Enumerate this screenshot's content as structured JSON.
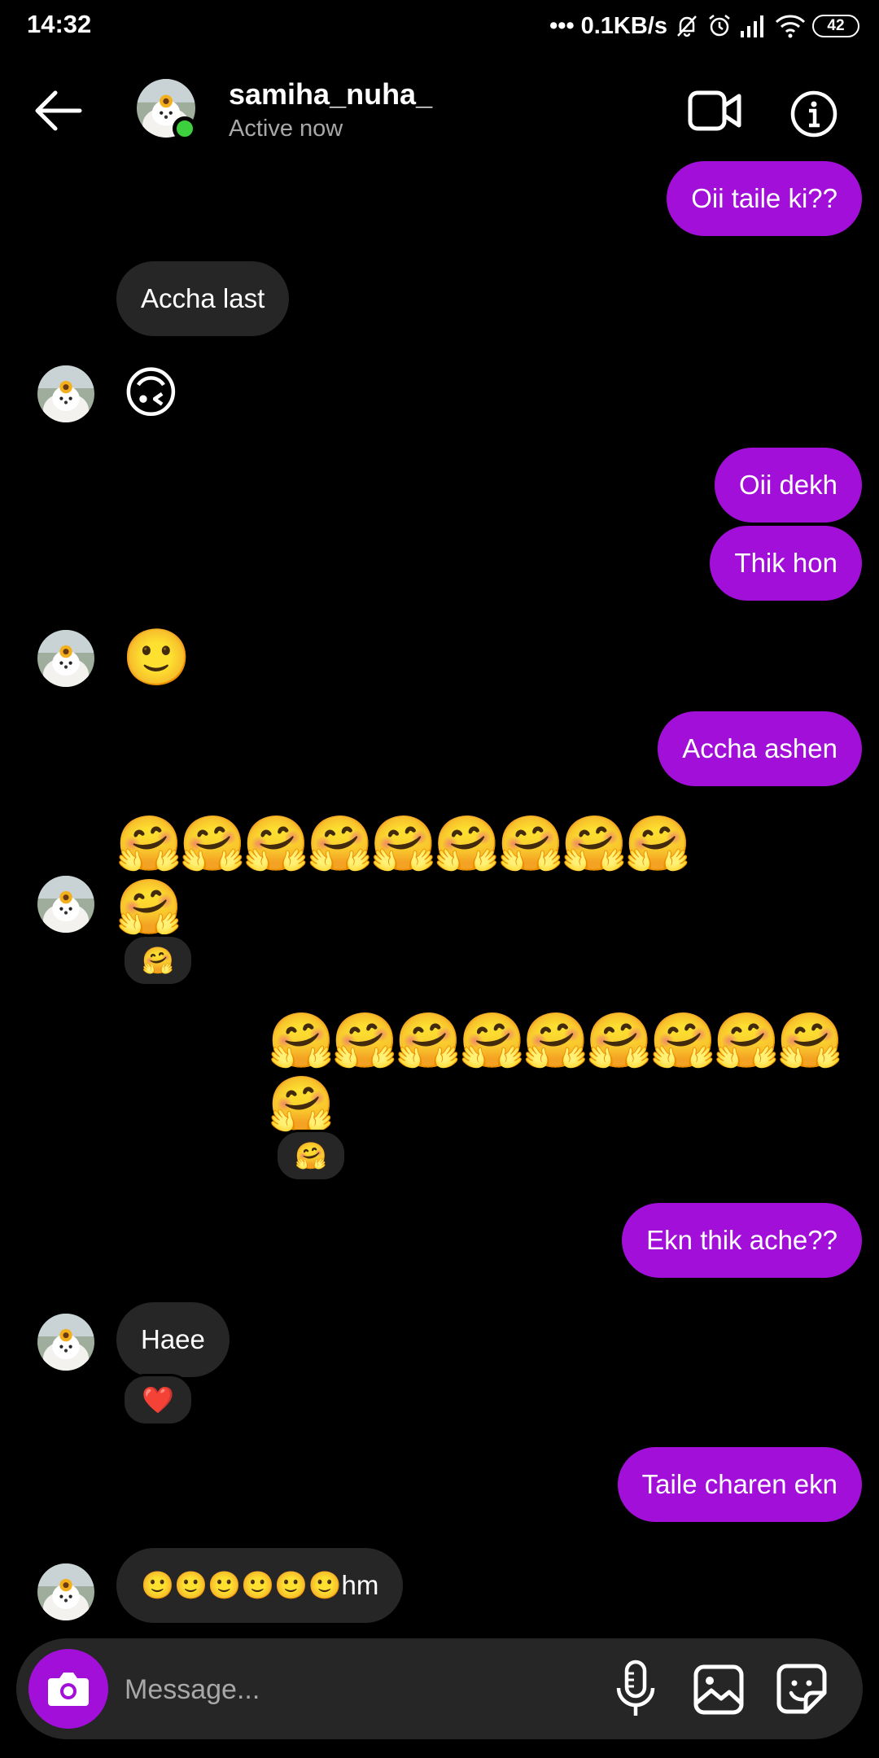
{
  "status_bar": {
    "time": "14:32",
    "network_speed": "0.1KB/s",
    "battery": "42"
  },
  "header": {
    "username": "samiha_nuha_",
    "status": "Active now"
  },
  "messages": [
    {
      "text": "Oii taile ki??"
    },
    {
      "text": "Accha last"
    },
    {
      "text": "🙃"
    },
    {
      "text": "Oii dekh"
    },
    {
      "text": "Thik hon"
    },
    {
      "text": "🙂"
    },
    {
      "text": "Accha ashen"
    },
    {
      "text": "🤗🤗🤗🤗🤗🤗🤗🤗🤗",
      "text2": "🤗",
      "reaction": "🤗"
    },
    {
      "text": "🤗🤗🤗🤗🤗🤗🤗🤗🤗",
      "text2": "🤗",
      "reaction": "🤗"
    },
    {
      "text": "Ekn thik ache??"
    },
    {
      "text": "Haee",
      "reaction": "❤️"
    },
    {
      "text": "Taile charen ekn"
    },
    {
      "text": "🙂🙂🙂🙂🙂🙂hm"
    }
  ],
  "composer": {
    "placeholder": "Message..."
  },
  "colors": {
    "sent_bubble": "#a10fd8",
    "received_bubble": "#262626",
    "background": "#000000",
    "online": "#3dcf3d"
  },
  "icons": [
    "back-arrow-icon",
    "video-call-icon",
    "info-icon",
    "camera-icon",
    "microphone-icon",
    "gallery-icon",
    "sticker-icon"
  ]
}
